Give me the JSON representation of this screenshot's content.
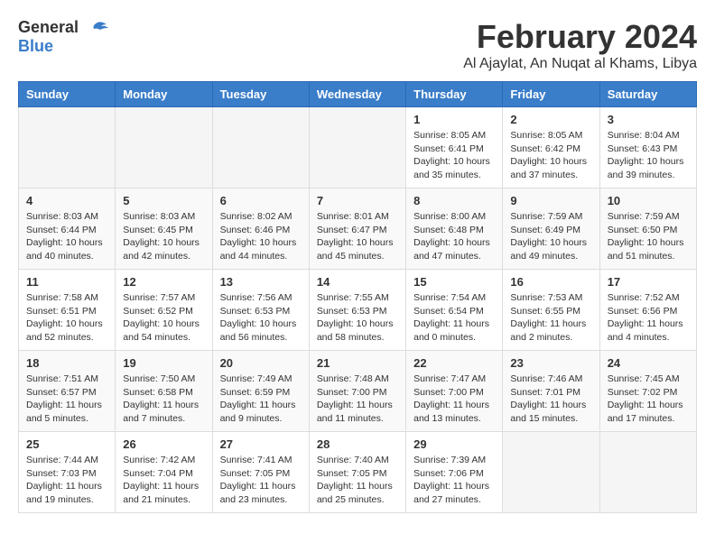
{
  "header": {
    "logo_general": "General",
    "logo_blue": "Blue",
    "month_title": "February 2024",
    "location": "Al Ajaylat, An Nuqat al Khams, Libya"
  },
  "weekdays": [
    "Sunday",
    "Monday",
    "Tuesday",
    "Wednesday",
    "Thursday",
    "Friday",
    "Saturday"
  ],
  "weeks": [
    [
      {
        "day": "",
        "info": ""
      },
      {
        "day": "",
        "info": ""
      },
      {
        "day": "",
        "info": ""
      },
      {
        "day": "",
        "info": ""
      },
      {
        "day": "1",
        "info": "Sunrise: 8:05 AM\nSunset: 6:41 PM\nDaylight: 10 hours\nand 35 minutes."
      },
      {
        "day": "2",
        "info": "Sunrise: 8:05 AM\nSunset: 6:42 PM\nDaylight: 10 hours\nand 37 minutes."
      },
      {
        "day": "3",
        "info": "Sunrise: 8:04 AM\nSunset: 6:43 PM\nDaylight: 10 hours\nand 39 minutes."
      }
    ],
    [
      {
        "day": "4",
        "info": "Sunrise: 8:03 AM\nSunset: 6:44 PM\nDaylight: 10 hours\nand 40 minutes."
      },
      {
        "day": "5",
        "info": "Sunrise: 8:03 AM\nSunset: 6:45 PM\nDaylight: 10 hours\nand 42 minutes."
      },
      {
        "day": "6",
        "info": "Sunrise: 8:02 AM\nSunset: 6:46 PM\nDaylight: 10 hours\nand 44 minutes."
      },
      {
        "day": "7",
        "info": "Sunrise: 8:01 AM\nSunset: 6:47 PM\nDaylight: 10 hours\nand 45 minutes."
      },
      {
        "day": "8",
        "info": "Sunrise: 8:00 AM\nSunset: 6:48 PM\nDaylight: 10 hours\nand 47 minutes."
      },
      {
        "day": "9",
        "info": "Sunrise: 7:59 AM\nSunset: 6:49 PM\nDaylight: 10 hours\nand 49 minutes."
      },
      {
        "day": "10",
        "info": "Sunrise: 7:59 AM\nSunset: 6:50 PM\nDaylight: 10 hours\nand 51 minutes."
      }
    ],
    [
      {
        "day": "11",
        "info": "Sunrise: 7:58 AM\nSunset: 6:51 PM\nDaylight: 10 hours\nand 52 minutes."
      },
      {
        "day": "12",
        "info": "Sunrise: 7:57 AM\nSunset: 6:52 PM\nDaylight: 10 hours\nand 54 minutes."
      },
      {
        "day": "13",
        "info": "Sunrise: 7:56 AM\nSunset: 6:53 PM\nDaylight: 10 hours\nand 56 minutes."
      },
      {
        "day": "14",
        "info": "Sunrise: 7:55 AM\nSunset: 6:53 PM\nDaylight: 10 hours\nand 58 minutes."
      },
      {
        "day": "15",
        "info": "Sunrise: 7:54 AM\nSunset: 6:54 PM\nDaylight: 11 hours\nand 0 minutes."
      },
      {
        "day": "16",
        "info": "Sunrise: 7:53 AM\nSunset: 6:55 PM\nDaylight: 11 hours\nand 2 minutes."
      },
      {
        "day": "17",
        "info": "Sunrise: 7:52 AM\nSunset: 6:56 PM\nDaylight: 11 hours\nand 4 minutes."
      }
    ],
    [
      {
        "day": "18",
        "info": "Sunrise: 7:51 AM\nSunset: 6:57 PM\nDaylight: 11 hours\nand 5 minutes."
      },
      {
        "day": "19",
        "info": "Sunrise: 7:50 AM\nSunset: 6:58 PM\nDaylight: 11 hours\nand 7 minutes."
      },
      {
        "day": "20",
        "info": "Sunrise: 7:49 AM\nSunset: 6:59 PM\nDaylight: 11 hours\nand 9 minutes."
      },
      {
        "day": "21",
        "info": "Sunrise: 7:48 AM\nSunset: 7:00 PM\nDaylight: 11 hours\nand 11 minutes."
      },
      {
        "day": "22",
        "info": "Sunrise: 7:47 AM\nSunset: 7:00 PM\nDaylight: 11 hours\nand 13 minutes."
      },
      {
        "day": "23",
        "info": "Sunrise: 7:46 AM\nSunset: 7:01 PM\nDaylight: 11 hours\nand 15 minutes."
      },
      {
        "day": "24",
        "info": "Sunrise: 7:45 AM\nSunset: 7:02 PM\nDaylight: 11 hours\nand 17 minutes."
      }
    ],
    [
      {
        "day": "25",
        "info": "Sunrise: 7:44 AM\nSunset: 7:03 PM\nDaylight: 11 hours\nand 19 minutes."
      },
      {
        "day": "26",
        "info": "Sunrise: 7:42 AM\nSunset: 7:04 PM\nDaylight: 11 hours\nand 21 minutes."
      },
      {
        "day": "27",
        "info": "Sunrise: 7:41 AM\nSunset: 7:05 PM\nDaylight: 11 hours\nand 23 minutes."
      },
      {
        "day": "28",
        "info": "Sunrise: 7:40 AM\nSunset: 7:05 PM\nDaylight: 11 hours\nand 25 minutes."
      },
      {
        "day": "29",
        "info": "Sunrise: 7:39 AM\nSunset: 7:06 PM\nDaylight: 11 hours\nand 27 minutes."
      },
      {
        "day": "",
        "info": ""
      },
      {
        "day": "",
        "info": ""
      }
    ]
  ]
}
